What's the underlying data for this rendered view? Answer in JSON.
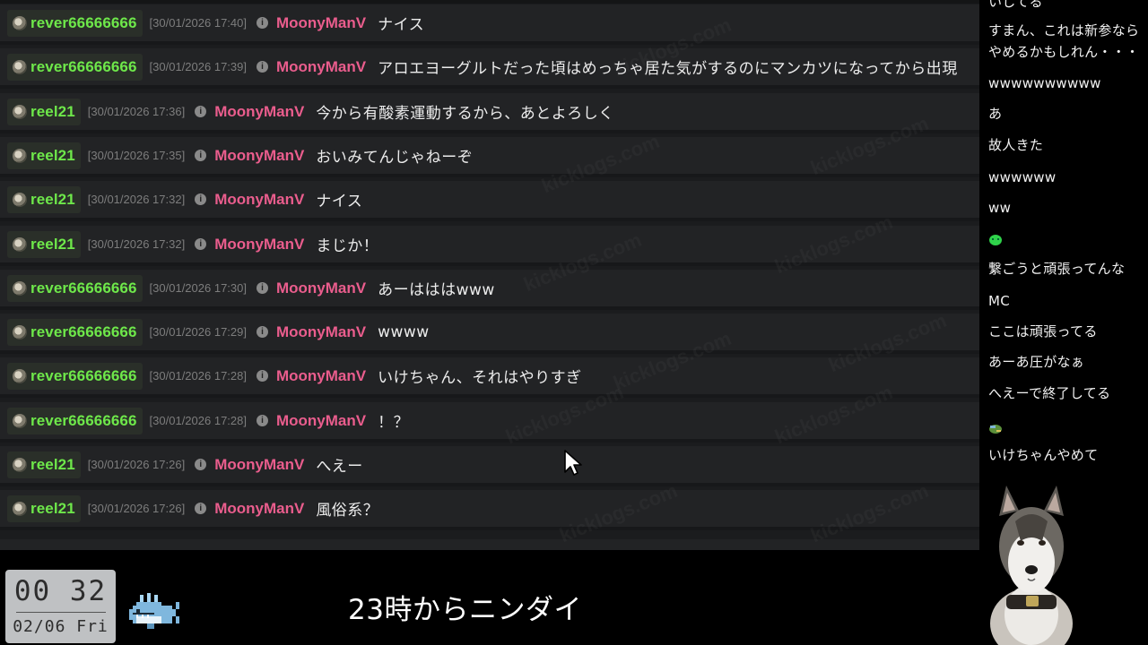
{
  "chat_log": {
    "streamer": "MoonyManV",
    "rows": [
      {
        "user": "rever66666666",
        "timestamp": "[30/01/2026 17:40]",
        "message": "ナイス"
      },
      {
        "user": "rever66666666",
        "timestamp": "[30/01/2026 17:39]",
        "message": "アロエヨーグルトだった頃はめっちゃ居た気がするのにマンカツになってから出現"
      },
      {
        "user": "reel21",
        "timestamp": "[30/01/2026 17:36]",
        "message": "今から有酸素運動するから、あとよろしく"
      },
      {
        "user": "reel21",
        "timestamp": "[30/01/2026 17:35]",
        "message": "おいみてんじゃねーぞ"
      },
      {
        "user": "reel21",
        "timestamp": "[30/01/2026 17:32]",
        "message": "ナイス"
      },
      {
        "user": "reel21",
        "timestamp": "[30/01/2026 17:32]",
        "message": "まじか！"
      },
      {
        "user": "rever66666666",
        "timestamp": "[30/01/2026 17:30]",
        "message": "あーはははwww"
      },
      {
        "user": "rever66666666",
        "timestamp": "[30/01/2026 17:29]",
        "message": "wwww"
      },
      {
        "user": "rever66666666",
        "timestamp": "[30/01/2026 17:28]",
        "message": "いけちゃん、それはやりすぎ"
      },
      {
        "user": "rever66666666",
        "timestamp": "[30/01/2026 17:28]",
        "message": "！？"
      },
      {
        "user": "reel21",
        "timestamp": "[30/01/2026 17:26]",
        "message": "へえー"
      },
      {
        "user": "reel21",
        "timestamp": "[30/01/2026 17:26]",
        "message": "風俗系？"
      }
    ],
    "info_icon": "i",
    "watermark": "kicklogs.com",
    "colors": {
      "username": "#6ee84a",
      "streamer": "#ea5d8d",
      "timestamp": "#7d7d7d"
    }
  },
  "overlay": {
    "comments": [
      {
        "kind": "text",
        "text": "いしてる"
      },
      {
        "kind": "text",
        "text": "すまん、これは新参なら"
      },
      {
        "kind": "text",
        "text": "やめるかもしれん・・・"
      },
      {
        "kind": "text",
        "text": "wwwwwwwwww"
      },
      {
        "kind": "text",
        "text": "あ"
      },
      {
        "kind": "text",
        "text": "故人きた"
      },
      {
        "kind": "text",
        "text": "wwwwww"
      },
      {
        "kind": "text",
        "text": "ww"
      },
      {
        "kind": "emote",
        "icon": "green-blob-emote-icon"
      },
      {
        "kind": "text",
        "text": "繋ごうと頑張ってんな"
      },
      {
        "kind": "text",
        "text": "MC"
      },
      {
        "kind": "text",
        "text": "ここは頑張ってる"
      },
      {
        "kind": "text",
        "text": "あーあ圧がなぁ"
      },
      {
        "kind": "text",
        "text": "へえーで終了してる"
      },
      {
        "kind": "emote",
        "icon": "bird-emote-icon"
      },
      {
        "kind": "text",
        "text": "いけちゃんやめて"
      }
    ]
  },
  "clock": {
    "time": "00 32",
    "date": "02/06 Fri"
  },
  "ticker": {
    "text": "23時からニンダイ"
  },
  "icons": {
    "cursor": "mouse-pointer-icon",
    "mascot": "whale-mascot-icon",
    "avatar": "husky-dog-avatar"
  }
}
